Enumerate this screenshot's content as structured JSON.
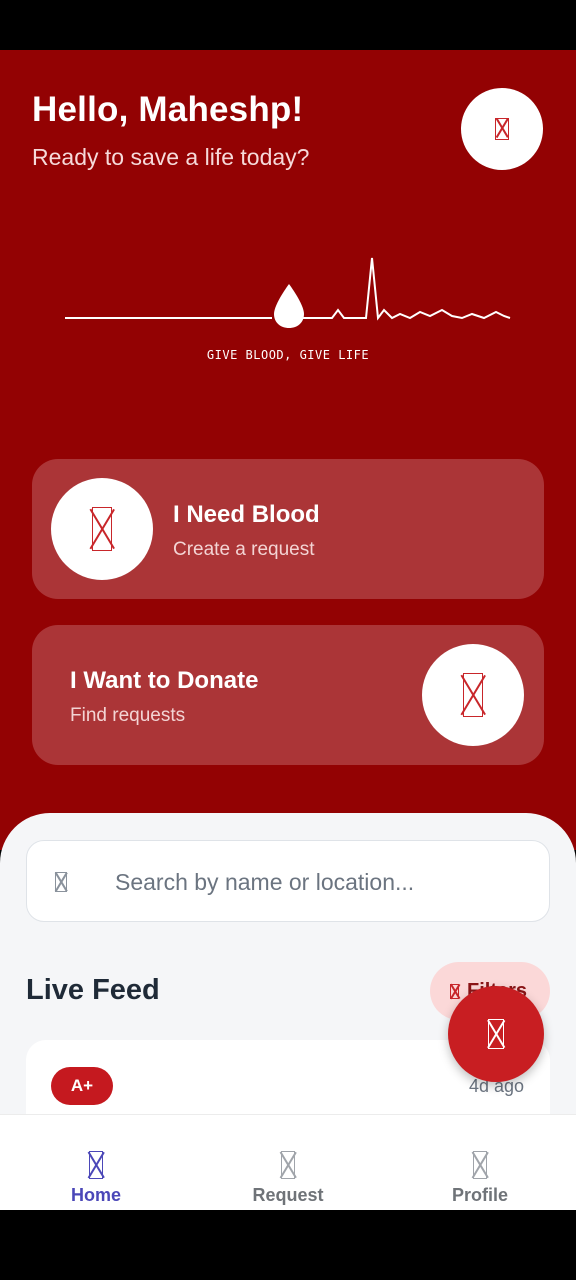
{
  "colors": {
    "primary": "#930203",
    "card_bg": "#ab3537",
    "accent": "#c81e22",
    "nav_active": "#4b47b8"
  },
  "header": {
    "greeting": "Hello, Maheshp!",
    "subtitle": "Ready to save a life today?",
    "notification_icon": "notification-icon"
  },
  "hero": {
    "tagline": "GIVE BLOOD, GIVE LIFE"
  },
  "actions": [
    {
      "title": "I Need Blood",
      "subtitle": "Create a request",
      "icon": "blood-drop-icon"
    },
    {
      "title": "I Want to Donate",
      "subtitle": "Find requests",
      "icon": "donate-hand-icon"
    }
  ],
  "search": {
    "placeholder": "Search by name or location..."
  },
  "feed": {
    "title": "Live Feed",
    "filters_label": "Filters",
    "items": [
      {
        "blood_group": "A+",
        "time_ago": "4d ago"
      }
    ]
  },
  "nav": {
    "items": [
      {
        "label": "Home",
        "icon": "home-icon",
        "active": true
      },
      {
        "label": "Request",
        "icon": "request-icon",
        "active": false
      },
      {
        "label": "Profile",
        "icon": "profile-icon",
        "active": false
      }
    ]
  }
}
